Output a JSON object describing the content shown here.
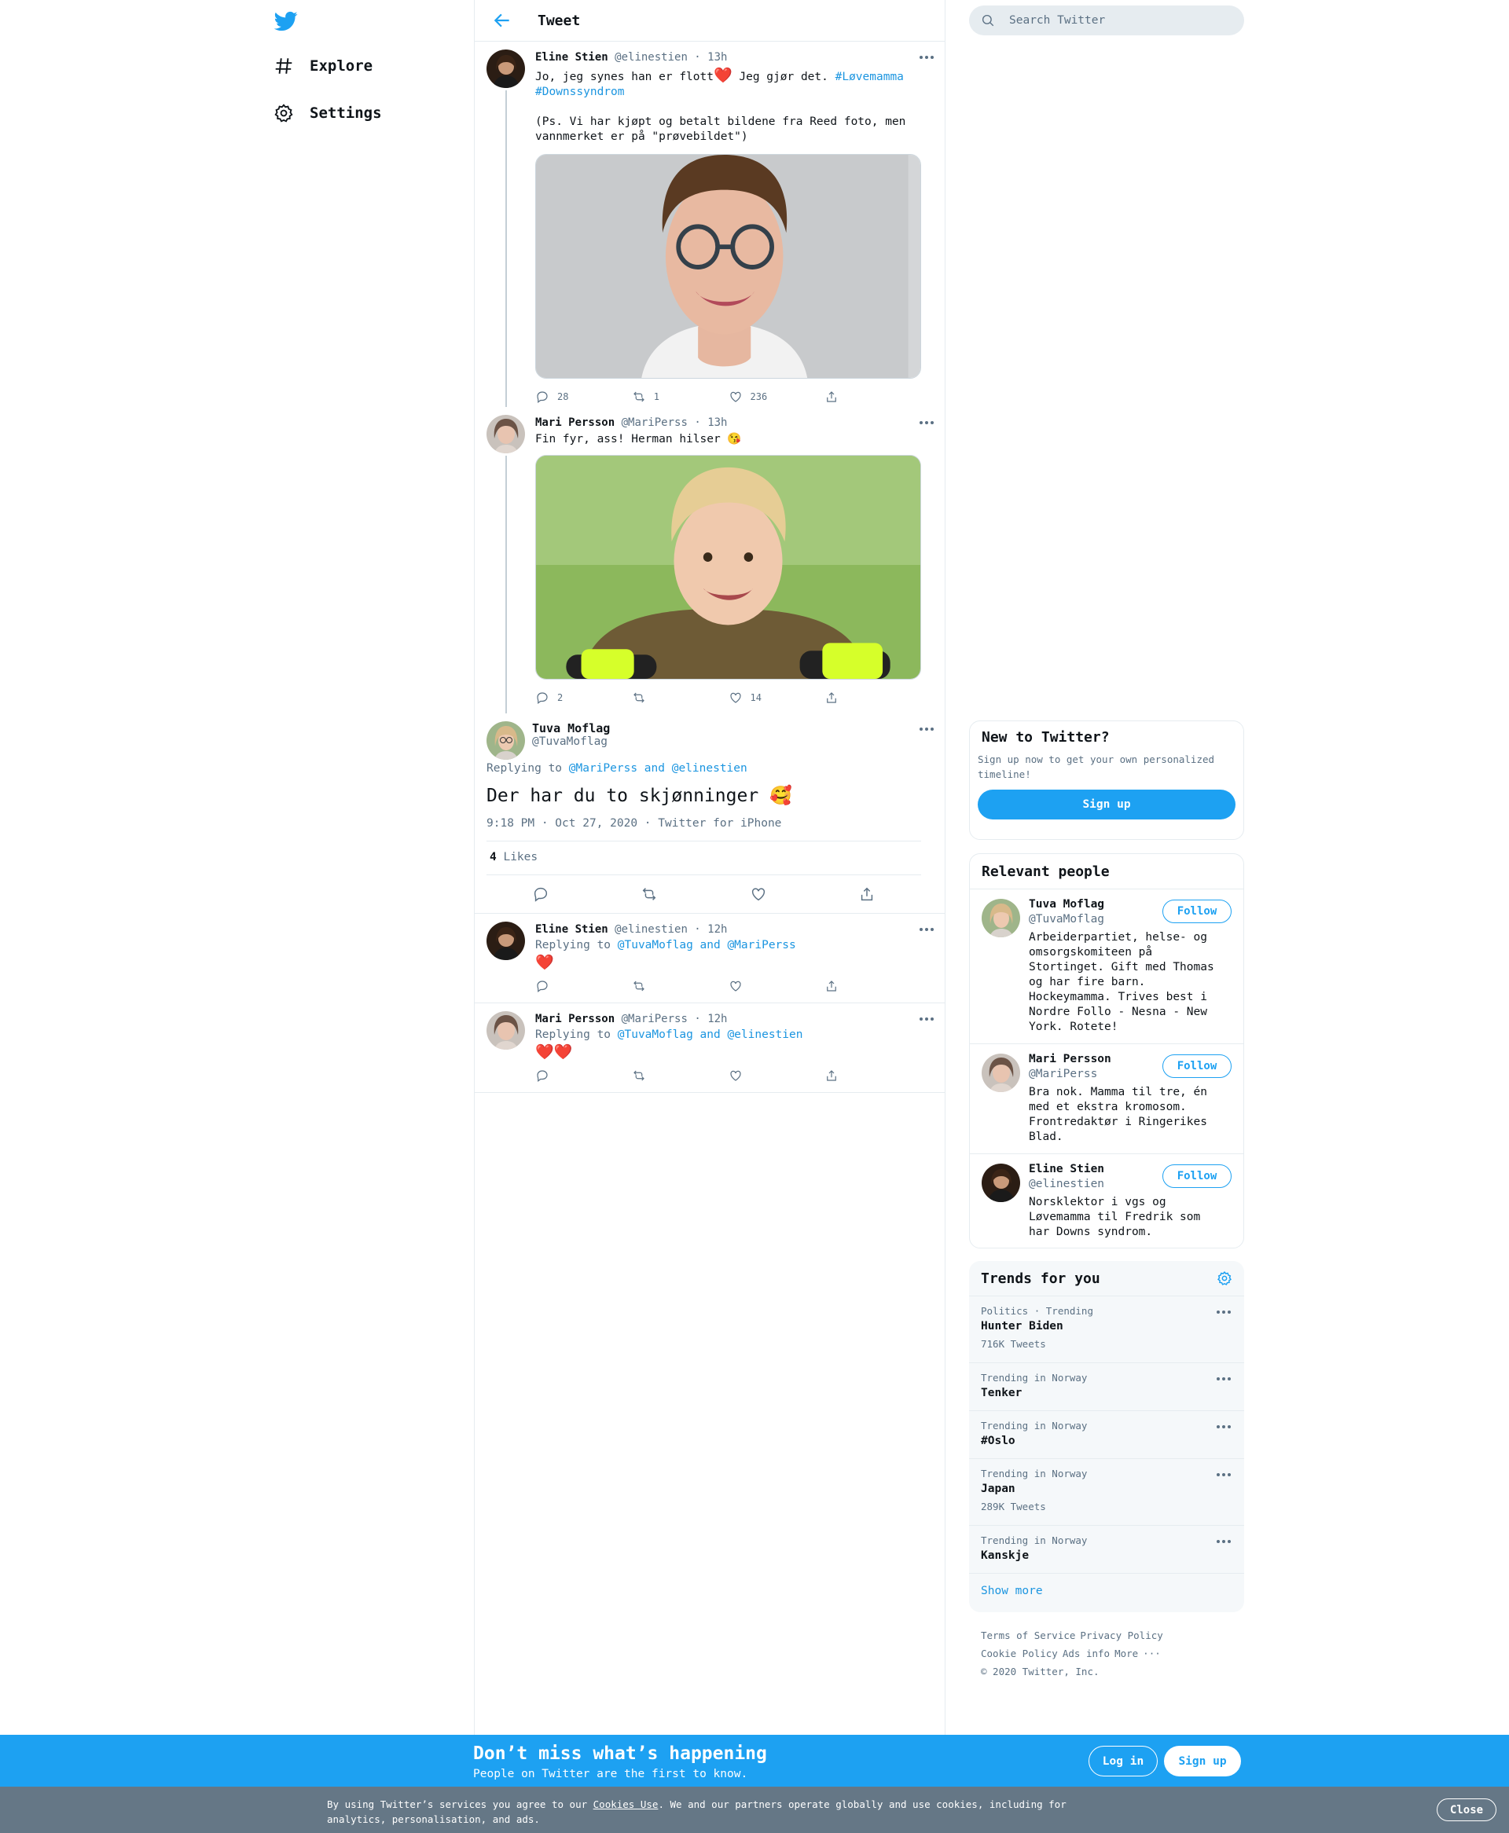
{
  "nav": {
    "logo": "twitter-bird-icon",
    "items": [
      {
        "label": "Explore",
        "icon": "hashtag-icon"
      },
      {
        "label": "Settings",
        "icon": "gear-icon"
      }
    ]
  },
  "header": {
    "title": "Tweet",
    "back_icon": "arrow-left-icon"
  },
  "thread": [
    {
      "name": "Eline Stien",
      "handle": "@elinestien",
      "time": "13h",
      "text_a": "Jo, jeg synes han er flott",
      "emoji": "❤️",
      "text_b": " Jeg gjør det. ",
      "hashtags": [
        "#Løvemamma",
        "#Downssyndrom"
      ],
      "text_c": "(Ps. Vi har kjøpt og betalt bildene fra Reed foto, men vannmerket er på \"prøvebildet\")",
      "stats": {
        "replies": "28",
        "retweets": "1",
        "likes": "236"
      }
    },
    {
      "name": "Mari Persson",
      "handle": "@MariPerss",
      "time": "13h",
      "text": "Fin fyr, ass! Herman hilser 😘",
      "stats": {
        "replies": "2",
        "retweets": "",
        "likes": "14"
      }
    }
  ],
  "focus": {
    "name": "Tuva Moflag",
    "handle": "@TuvaMoflag",
    "replying_prefix": "Replying to ",
    "replying_to": "@MariPerss and @elinestien",
    "text": "Der har du to skjønninger 🥰",
    "time": "9:18 PM · Oct 27, 2020",
    "source": "Twitter for iPhone",
    "likes_count": "4",
    "likes_label": "Likes"
  },
  "replies": [
    {
      "name": "Eline Stien",
      "handle": "@elinestien",
      "time": "12h",
      "replying_prefix": "Replying to ",
      "replying_to": "@TuvaMoflag and @MariPerss",
      "text": "❤️"
    },
    {
      "name": "Mari Persson",
      "handle": "@MariPerss",
      "time": "12h",
      "replying_prefix": "Replying to ",
      "replying_to": "@TuvaMoflag and @elinestien",
      "text": "❤️❤️"
    }
  ],
  "search": {
    "placeholder": "Search Twitter"
  },
  "new_to_twitter": {
    "title": "New to Twitter?",
    "text": "Sign up now to get your own personalized timeline!",
    "button": "Sign up"
  },
  "relevant_people": {
    "title": "Relevant people",
    "people": [
      {
        "name": "Tuva Moflag",
        "handle": "@TuvaMoflag",
        "button": "Follow",
        "bio": "Arbeiderpartiet, helse- og omsorgskomiteen på Stortinget. Gift med Thomas og har fire barn. Hockeymamma. Trives best i Nordre Follo - Nesna - New York. Rotete!"
      },
      {
        "name": "Mari Persson",
        "handle": "@MariPerss",
        "button": "Follow",
        "bio": "Bra nok. Mamma til tre, én med et ekstra kromosom. Frontredaktør i Ringerikes Blad."
      },
      {
        "name": "Eline Stien",
        "handle": "@elinestien",
        "button": "Follow",
        "bio": "Norsklektor i vgs og Løvemamma til Fredrik som har Downs syndrom."
      }
    ]
  },
  "trends": {
    "title": "Trends for you",
    "items": [
      {
        "meta": "Politics · Trending",
        "name": "Hunter Biden",
        "count": "716K Tweets"
      },
      {
        "meta": "Trending in Norway",
        "name": "Tenker",
        "count": ""
      },
      {
        "meta": "Trending in Norway",
        "name": "#Oslo",
        "count": ""
      },
      {
        "meta": "Trending in Norway",
        "name": "Japan",
        "count": "289K Tweets"
      },
      {
        "meta": "Trending in Norway",
        "name": "Kanskje",
        "count": ""
      }
    ],
    "show_more": "Show more"
  },
  "footer": {
    "links": [
      "Terms of Service",
      "Privacy Policy",
      "Cookie Policy",
      "Ads info",
      "More"
    ],
    "copyright": "© 2020 Twitter, Inc."
  },
  "banner": {
    "title": "Don’t miss what’s happening",
    "subtitle": "People on Twitter are the first to know.",
    "login": "Log in",
    "signup": "Sign up"
  },
  "cookie": {
    "text_a": "By using Twitter’s services you agree to our ",
    "link": "Cookies Use",
    "text_b": ". We and our partners operate globally and use cookies, including for analytics, personalisation, and ads.",
    "close": "Close"
  },
  "colors": {
    "accent": "#1da1f2",
    "link": "#1b95e0",
    "border": "#e6ecf0",
    "muted": "#5b7083",
    "cookie_bg": "#657786",
    "heart": "#e0245e"
  }
}
